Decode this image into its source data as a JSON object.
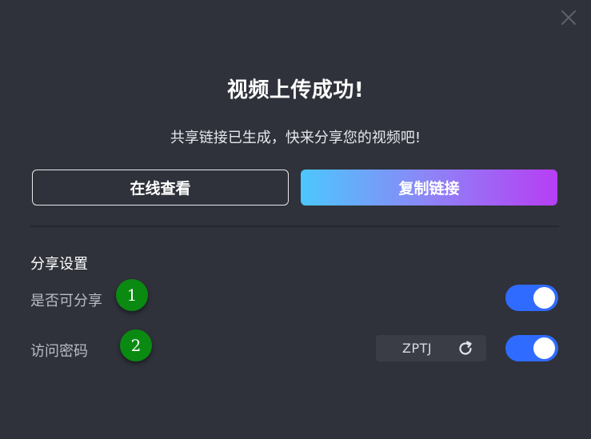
{
  "dialog": {
    "title": "视频上传成功!",
    "subtitle": "共享链接已生成，快来分享您的视频吧!",
    "close_icon": "close-icon",
    "buttons": {
      "view_online": "在线查看",
      "copy_link": "复制链接"
    },
    "share_settings": {
      "section_title": "分享设置",
      "shareable": {
        "label": "是否可分享",
        "enabled": true
      },
      "access_password": {
        "label": "访问密码",
        "value": "ZPTJ",
        "refresh_icon": "refresh-icon",
        "enabled": true
      }
    },
    "markers": [
      "1",
      "2"
    ],
    "colors": {
      "background": "#2f323a",
      "toggle_on": "#2f6bff",
      "copy_gradient_start": "#4cc7fd",
      "copy_gradient_end": "#b73ef4",
      "marker": "#0b8a12"
    }
  }
}
